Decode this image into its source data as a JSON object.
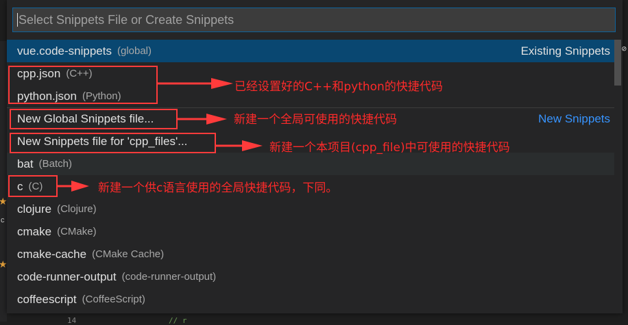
{
  "quick_pick": {
    "search_placeholder": "Select Snippets File or Create Snippets",
    "items": [
      {
        "label": "vue.code-snippets",
        "description": "(global)",
        "group": "Existing Snippets"
      },
      {
        "label": "cpp.json",
        "description": "(C++)"
      },
      {
        "label": "python.json",
        "description": "(Python)"
      },
      {
        "label": "New Global Snippets file...",
        "description": "",
        "group": "New Snippets"
      },
      {
        "label": "New Snippets file for 'cpp_files'...",
        "description": ""
      },
      {
        "label": "bat",
        "description": "(Batch)"
      },
      {
        "label": "c",
        "description": "(C)"
      },
      {
        "label": "clojure",
        "description": "(Clojure)"
      },
      {
        "label": "cmake",
        "description": "(CMake)"
      },
      {
        "label": "cmake-cache",
        "description": "(CMake Cache)"
      },
      {
        "label": "code-runner-output",
        "description": "(code-runner-output)"
      },
      {
        "label": "coffeescript",
        "description": "(CoffeeScript)"
      }
    ]
  },
  "annotations": [
    {
      "text": "已经设置好的C++和python的快捷代码"
    },
    {
      "text": "新建一个全局可使用的快捷代码"
    },
    {
      "text": "新建一个本项目(cpp_file)中可使用的快捷代码"
    },
    {
      "text": "新建一个供c语言使用的全局快捷代码，下同。"
    }
  ],
  "editor": {
    "line_number": "14",
    "code_fragment": "//  r",
    "gutter_glyph": "c"
  },
  "colors": {
    "accent": "#0e639c",
    "selection": "#094771",
    "annotation": "#ff2a2a",
    "existing_group": "#e0e0e0",
    "new_group": "#3794ff"
  }
}
